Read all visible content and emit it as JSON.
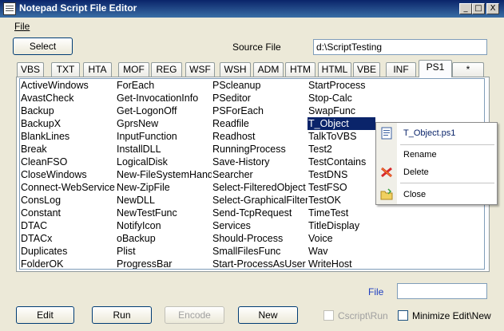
{
  "window": {
    "title": "Notepad Script File Editor",
    "min_glyph": "_",
    "max_glyph": "□",
    "close_glyph": "X"
  },
  "menu": {
    "file_label": "File"
  },
  "toolbar": {
    "select_label": "Select",
    "source_file_label": "Source File",
    "source_file_value": "d:\\ScriptTesting"
  },
  "tabs": [
    "VBS",
    "TXT",
    "HTA",
    "MOF",
    "REG",
    "WSF",
    "WSH",
    "ADM",
    "HTM",
    "HTML",
    "VBE",
    "INF",
    "PS1",
    "*"
  ],
  "active_tab": "PS1",
  "files": {
    "col1": [
      "ActiveWindows",
      "AvastCheck",
      "Backup",
      "BackupX",
      "BlankLines",
      "Break",
      "CleanFSO",
      "CloseWindows",
      "Connect-WebService",
      "ConsLog",
      "Constant",
      "DTAC",
      "DTACx",
      "Duplicates",
      "FolderOK"
    ],
    "col2": [
      "ForEach",
      "Get-InvocationInfo",
      "Get-LogonOff",
      "GprsNew",
      "InputFunction",
      "InstallDLL",
      "LogicalDisk",
      "New-FileSystemHandler",
      "New-ZipFile",
      "NewDLL",
      "NewTestFunc",
      "NotifyIcon",
      "oBackup",
      "Plist",
      "ProgressBar"
    ],
    "col3": [
      "PScleanup",
      "PSeditor",
      "PSForEach",
      "Readfile",
      "Readhost",
      "RunningProcess",
      "Save-History",
      "Searcher",
      "Select-FilteredObject",
      "Select-GraphicalFilter",
      "Send-TcpRequest",
      "Services",
      "Should-Process",
      "SmallFilesFunc",
      "Start-ProcessAsUser"
    ],
    "col4": [
      "StartProcess",
      "Stop-Calc",
      "SwapFunc",
      "T_Object",
      "TalkToVBS",
      "Test2",
      "TestContains",
      "TestDNS",
      "TestFSO",
      "TestOK",
      "TimeTest",
      "TitleDisplay",
      "Voice",
      "Wav",
      "WriteHost"
    ]
  },
  "selected_file": "T_Object",
  "context_menu": {
    "header": "T_Object.ps1",
    "rename": "Rename",
    "delete": "Delete",
    "close": "Close"
  },
  "bottom": {
    "file_label": "File",
    "file_value": "",
    "edit_label": "Edit",
    "run_label": "Run",
    "encode_label": "Encode",
    "new_label": "New",
    "cscript_label": "Cscript\\Run",
    "minimize_label": "Minimize Edit\\New"
  },
  "colors": {
    "titlebar": "#0a246a",
    "selection": "#0a246a",
    "context_header": "#0a246a"
  }
}
